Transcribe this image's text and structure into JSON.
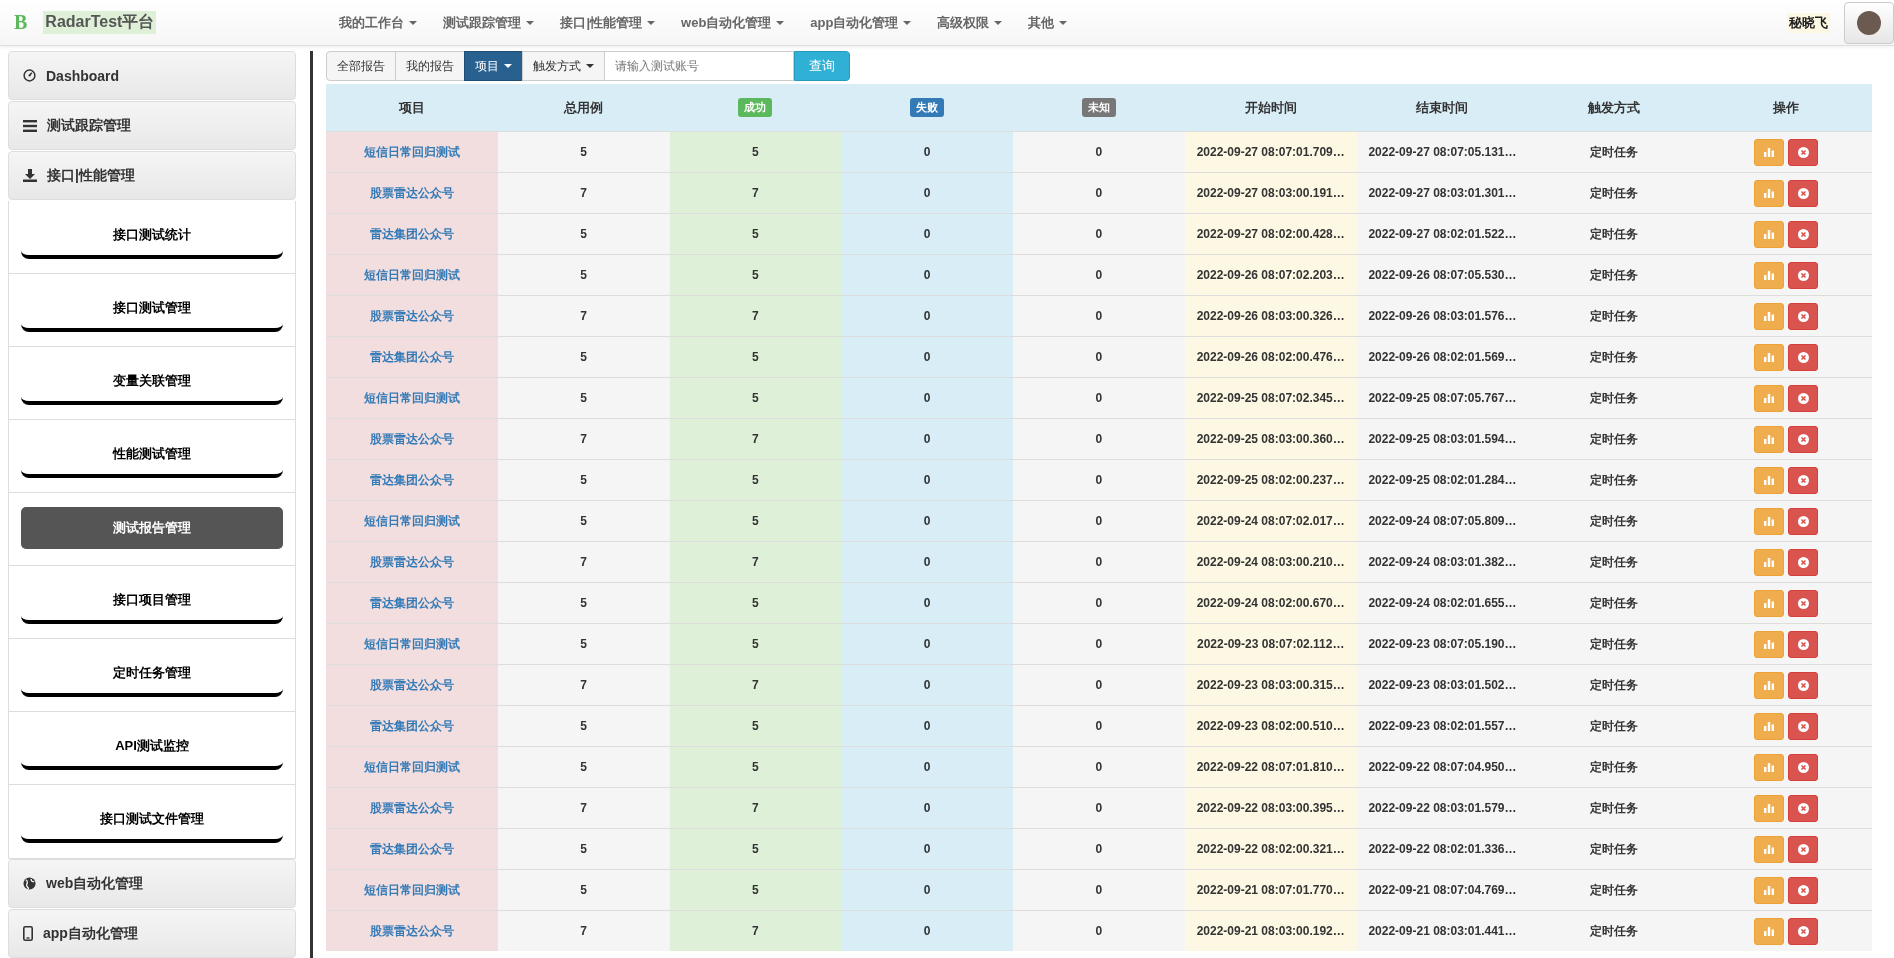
{
  "navbar": {
    "logo": "B",
    "brand": "RadarTest平台",
    "menu": [
      {
        "label": "我的工作台"
      },
      {
        "label": "测试跟踪管理"
      },
      {
        "label": "接口|性能管理"
      },
      {
        "label": "web自动化管理"
      },
      {
        "label": "app自动化管理"
      },
      {
        "label": "高级权限"
      },
      {
        "label": "其他"
      }
    ],
    "user": "秘晓飞"
  },
  "sidebar": {
    "items": [
      {
        "label": "Dashboard"
      },
      {
        "label": "测试跟踪管理"
      },
      {
        "label": "接口|性能管理",
        "children": [
          {
            "label": "接口测试统计",
            "selected": false
          },
          {
            "label": "接口测试管理",
            "selected": false
          },
          {
            "label": "变量关联管理",
            "selected": false
          },
          {
            "label": "性能测试管理",
            "selected": false
          },
          {
            "label": "测试报告管理",
            "selected": true
          },
          {
            "label": "接口项目管理",
            "selected": false
          },
          {
            "label": "定时任务管理",
            "selected": false
          },
          {
            "label": "API测试监控",
            "selected": false
          },
          {
            "label": "接口测试文件管理",
            "selected": false
          }
        ]
      },
      {
        "label": "web自动化管理"
      },
      {
        "label": "app自动化管理"
      }
    ]
  },
  "toolbar": {
    "buttons": [
      {
        "label": "全部报告",
        "kind": "button",
        "selected": false
      },
      {
        "label": "我的报告",
        "kind": "button",
        "selected": false
      },
      {
        "label": "项目",
        "kind": "dropdown",
        "selected": true
      },
      {
        "label": "触发方式",
        "kind": "dropdown",
        "selected": false
      }
    ],
    "search": {
      "placeholder": "请输入测试账号"
    },
    "submit": "查询"
  },
  "table": {
    "columns": [
      {
        "label": "项目",
        "kind": "text"
      },
      {
        "label": "总用例",
        "kind": "text"
      },
      {
        "label": "成功",
        "kind": "badge",
        "color": "#5cb85c"
      },
      {
        "label": "失败",
        "kind": "badge",
        "color": "#337ab7"
      },
      {
        "label": "未知",
        "kind": "badge",
        "color": "#777777"
      },
      {
        "label": "开始时间",
        "kind": "text"
      },
      {
        "label": "结束时间",
        "kind": "text"
      },
      {
        "label": "触发方式",
        "kind": "text"
      },
      {
        "label": "操作",
        "kind": "text"
      }
    ],
    "rows": [
      {
        "project": "短信日常回归测试",
        "total": "5",
        "success": "5",
        "failed": "0",
        "unknown": "0",
        "start": "2022-09-27 08:07:01.709…",
        "end": "2022-09-27 08:07:05.131…",
        "trigger": "定时任务"
      },
      {
        "project": "股票雷达公众号",
        "total": "7",
        "success": "7",
        "failed": "0",
        "unknown": "0",
        "start": "2022-09-27 08:03:00.191…",
        "end": "2022-09-27 08:03:01.301…",
        "trigger": "定时任务"
      },
      {
        "project": "雷达集团公众号",
        "total": "5",
        "success": "5",
        "failed": "0",
        "unknown": "0",
        "start": "2022-09-27 08:02:00.428…",
        "end": "2022-09-27 08:02:01.522…",
        "trigger": "定时任务"
      },
      {
        "project": "短信日常回归测试",
        "total": "5",
        "success": "5",
        "failed": "0",
        "unknown": "0",
        "start": "2022-09-26 08:07:02.203…",
        "end": "2022-09-26 08:07:05.530…",
        "trigger": "定时任务"
      },
      {
        "project": "股票雷达公众号",
        "total": "7",
        "success": "7",
        "failed": "0",
        "unknown": "0",
        "start": "2022-09-26 08:03:00.326…",
        "end": "2022-09-26 08:03:01.576…",
        "trigger": "定时任务"
      },
      {
        "project": "雷达集团公众号",
        "total": "5",
        "success": "5",
        "failed": "0",
        "unknown": "0",
        "start": "2022-09-26 08:02:00.476…",
        "end": "2022-09-26 08:02:01.569…",
        "trigger": "定时任务"
      },
      {
        "project": "短信日常回归测试",
        "total": "5",
        "success": "5",
        "failed": "0",
        "unknown": "0",
        "start": "2022-09-25 08:07:02.345…",
        "end": "2022-09-25 08:07:05.767…",
        "trigger": "定时任务"
      },
      {
        "project": "股票雷达公众号",
        "total": "7",
        "success": "7",
        "failed": "0",
        "unknown": "0",
        "start": "2022-09-25 08:03:00.360…",
        "end": "2022-09-25 08:03:01.594…",
        "trigger": "定时任务"
      },
      {
        "project": "雷达集团公众号",
        "total": "5",
        "success": "5",
        "failed": "0",
        "unknown": "0",
        "start": "2022-09-25 08:02:00.237…",
        "end": "2022-09-25 08:02:01.284…",
        "trigger": "定时任务"
      },
      {
        "project": "短信日常回归测试",
        "total": "5",
        "success": "5",
        "failed": "0",
        "unknown": "0",
        "start": "2022-09-24 08:07:02.017…",
        "end": "2022-09-24 08:07:05.809…",
        "trigger": "定时任务"
      },
      {
        "project": "股票雷达公众号",
        "total": "7",
        "success": "7",
        "failed": "0",
        "unknown": "0",
        "start": "2022-09-24 08:03:00.210…",
        "end": "2022-09-24 08:03:01.382…",
        "trigger": "定时任务"
      },
      {
        "project": "雷达集团公众号",
        "total": "5",
        "success": "5",
        "failed": "0",
        "unknown": "0",
        "start": "2022-09-24 08:02:00.670…",
        "end": "2022-09-24 08:02:01.655…",
        "trigger": "定时任务"
      },
      {
        "project": "短信日常回归测试",
        "total": "5",
        "success": "5",
        "failed": "0",
        "unknown": "0",
        "start": "2022-09-23 08:07:02.112…",
        "end": "2022-09-23 08:07:05.190…",
        "trigger": "定时任务"
      },
      {
        "project": "股票雷达公众号",
        "total": "7",
        "success": "7",
        "failed": "0",
        "unknown": "0",
        "start": "2022-09-23 08:03:00.315…",
        "end": "2022-09-23 08:03:01.502…",
        "trigger": "定时任务"
      },
      {
        "project": "雷达集团公众号",
        "total": "5",
        "success": "5",
        "failed": "0",
        "unknown": "0",
        "start": "2022-09-23 08:02:00.510…",
        "end": "2022-09-23 08:02:01.557…",
        "trigger": "定时任务"
      },
      {
        "project": "短信日常回归测试",
        "total": "5",
        "success": "5",
        "failed": "0",
        "unknown": "0",
        "start": "2022-09-22 08:07:01.810…",
        "end": "2022-09-22 08:07:04.950…",
        "trigger": "定时任务"
      },
      {
        "project": "股票雷达公众号",
        "total": "7",
        "success": "7",
        "failed": "0",
        "unknown": "0",
        "start": "2022-09-22 08:03:00.395…",
        "end": "2022-09-22 08:03:01.579…",
        "trigger": "定时任务"
      },
      {
        "project": "雷达集团公众号",
        "total": "5",
        "success": "5",
        "failed": "0",
        "unknown": "0",
        "start": "2022-09-22 08:02:00.321…",
        "end": "2022-09-22 08:02:01.336…",
        "trigger": "定时任务"
      },
      {
        "project": "短信日常回归测试",
        "total": "5",
        "success": "5",
        "failed": "0",
        "unknown": "0",
        "start": "2022-09-21 08:07:01.770…",
        "end": "2022-09-21 08:07:04.769…",
        "trigger": "定时任务"
      },
      {
        "project": "股票雷达公众号",
        "total": "7",
        "success": "7",
        "failed": "0",
        "unknown": "0",
        "start": "2022-09-21 08:03:00.192…",
        "end": "2022-09-21 08:03:01.441…",
        "trigger": "定时任务"
      }
    ]
  }
}
